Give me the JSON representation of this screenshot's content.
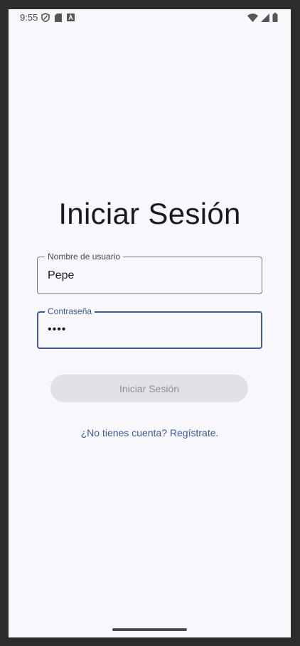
{
  "status_bar": {
    "time": "9:55",
    "left_icons": [
      "shield-icon",
      "sd-card-icon",
      "keyboard-a-icon"
    ],
    "right_icons": [
      "wifi-icon",
      "signal-icon",
      "battery-icon"
    ]
  },
  "login": {
    "title": "Iniciar Sesión",
    "username": {
      "label": "Nombre de usuario",
      "value": "Pepe"
    },
    "password": {
      "label": "Contraseña",
      "value": "••••"
    },
    "submit_label": "Iniciar Sesión",
    "register_link": "¿No tienes cuenta? Regístrate."
  },
  "colors": {
    "background": "#f8f7fc",
    "accent": "#3b5a97",
    "button_disabled_bg": "#e2e1e6",
    "button_disabled_text": "#8d8e93"
  }
}
